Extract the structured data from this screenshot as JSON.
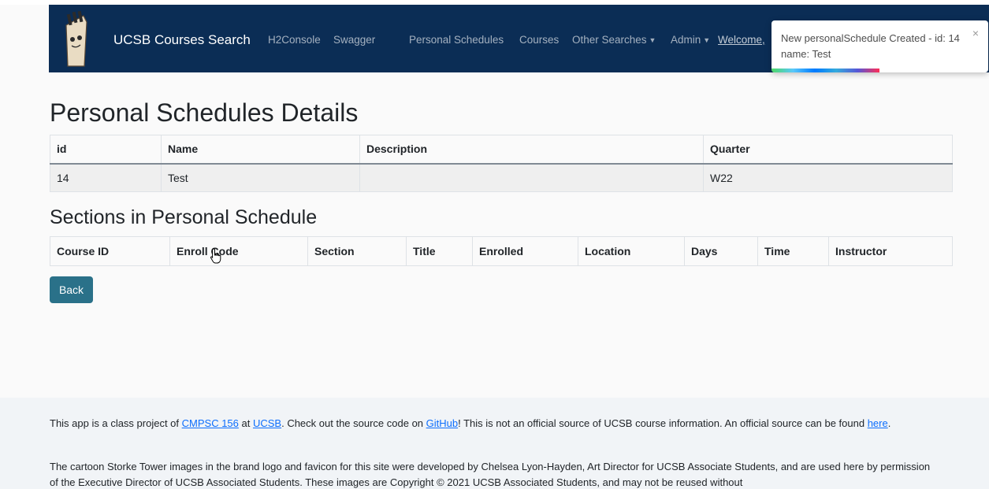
{
  "navbar": {
    "brand": "UCSB Courses Search",
    "links": [
      "H2Console",
      "Swagger",
      "Personal Schedules",
      "Courses"
    ],
    "dropdowns": [
      "Other Searches",
      "Admin"
    ],
    "welcome": "Welcome,"
  },
  "toast": {
    "message": "New personalSchedule Created - id: 14 name: Test",
    "close_symbol": "×"
  },
  "page": {
    "title": "Personal Schedules Details",
    "sections_title": "Sections in Personal Schedule",
    "back_label": "Back"
  },
  "details_table": {
    "headers": [
      "id",
      "Name",
      "Description",
      "Quarter"
    ],
    "row": [
      "14",
      "Test",
      "",
      "W22"
    ]
  },
  "sections_table": {
    "headers": [
      "Course ID",
      "Enroll Code",
      "Section",
      "Title",
      "Enrolled",
      "Location",
      "Days",
      "Time",
      "Instructor"
    ]
  },
  "footer": {
    "p1_a": "This app is a class project of ",
    "p1_link1": "CMPSC 156",
    "p1_b": " at ",
    "p1_link2": "UCSB",
    "p1_c": ". Check out the source code on ",
    "p1_link3": "GitHub",
    "p1_d": "! This is not an official source of UCSB course information. An official source can be found ",
    "p1_link4": "here",
    "p1_e": ".",
    "p2": "The cartoon Storke Tower images in the brand logo and favicon for this site were developed by Chelsea Lyon-Hayden, Art Director for UCSB Associate Students, and are used here by permission of the Executive Director of UCSB Associated Students. These images are Copyright © 2021 UCSB Associated Students, and may not be reused without"
  },
  "colors": {
    "navbar": "#0b2d55",
    "back_button": "#2a7189",
    "link": "#0d6efd"
  },
  "icons": [
    "storke-tower-logo-icon",
    "close-icon",
    "caret-down-icon",
    "hand-cursor-icon"
  ]
}
